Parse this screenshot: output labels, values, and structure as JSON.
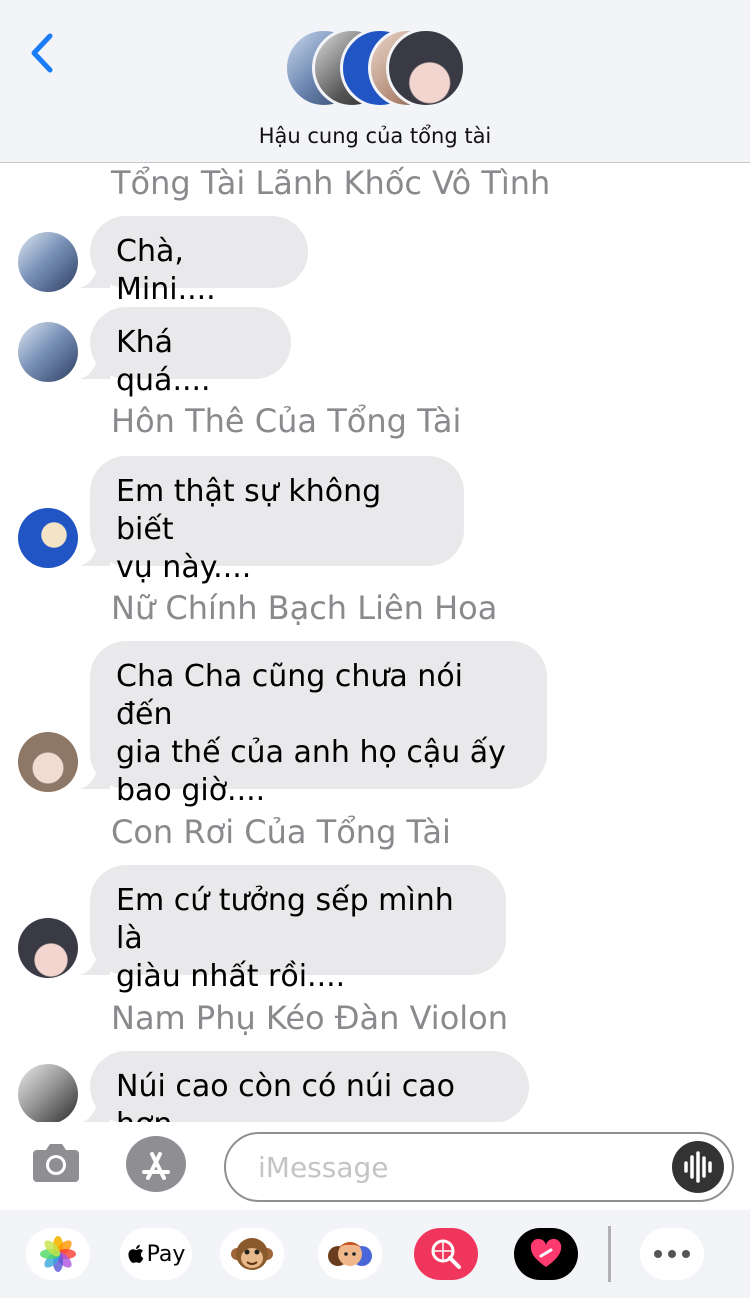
{
  "header": {
    "back_icon": "chevron-left-icon",
    "title": "Hậu cung của tổng tài",
    "accent": "#1a7cf6"
  },
  "messages": [
    {
      "sender": "Tổng Tài Lãnh Khốc Vô Tình",
      "text": "Chà, Mini...."
    },
    {
      "sender": "",
      "text": "Khá quá...."
    },
    {
      "sender": "Hôn Thê Của Tổng Tài",
      "lines": [
        "Em thật sự không biết",
        "vụ này...."
      ]
    },
    {
      "sender": "Nữ Chính Bạch Liên Hoa",
      "lines": [
        "Cha Cha cũng chưa nói đến",
        "gia thế của anh họ cậu ấy",
        "bao giờ...."
      ]
    },
    {
      "sender": "Con Rơi Của Tổng Tài",
      "lines": [
        "Em cứ tưởng sếp mình là",
        "giàu nhất rồi...."
      ]
    },
    {
      "sender": "Nam Phụ Kéo Đàn Violon",
      "text": "Núi cao còn có núi cao hơn"
    }
  ],
  "input": {
    "placeholder": "iMessage",
    "camera_icon": "camera-icon",
    "appstore_icon": "app-store-icon",
    "audio_icon": "audio-waveform-icon"
  },
  "apps": {
    "applepay_label": "Pay",
    "items": [
      "photos-icon",
      "apple-pay-icon",
      "animoji-monkey-icon",
      "memoji-icon",
      "web-search-icon",
      "digital-touch-heart-icon",
      "more-icon"
    ]
  },
  "colors": {
    "bubble": "#e9e9eb",
    "sender_text": "#8a8a8e",
    "header_bg": "#f3f4f8"
  }
}
